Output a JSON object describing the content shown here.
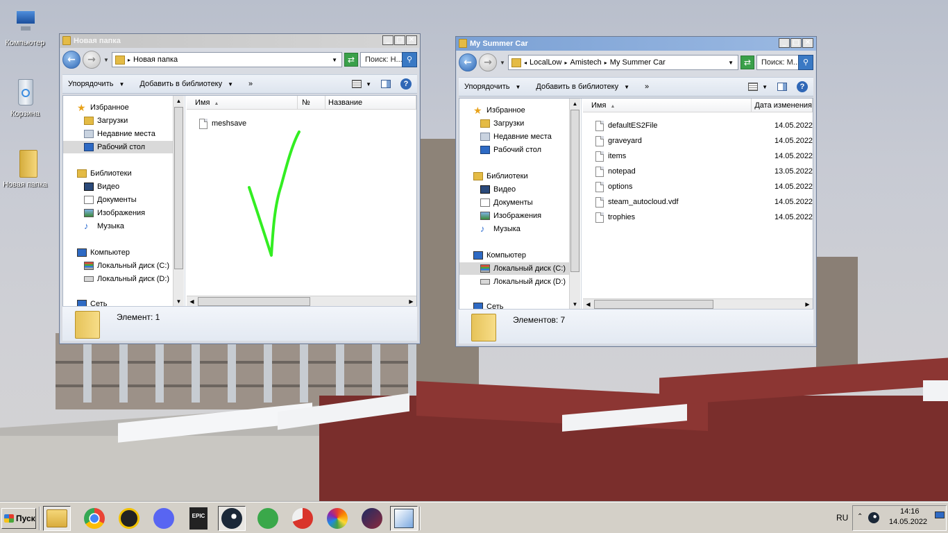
{
  "desktop": {
    "icons": [
      {
        "label": "Компьютер",
        "icon": "computer-icon"
      },
      {
        "label": "Корзина",
        "icon": "recycle-bin-icon"
      },
      {
        "label": "Новая папка",
        "icon": "folder-icon"
      }
    ]
  },
  "win1": {
    "title": "Новая папка",
    "path": [
      "Новая папка"
    ],
    "search_placeholder": "Поиск: Н...",
    "cmd": {
      "organize": "Упорядочить",
      "add_library": "Добавить в библиотеку",
      "more": "»"
    },
    "nav": {
      "favorites": "Избранное",
      "downloads": "Загрузки",
      "recent": "Недавние места",
      "desktop": "Рабочий стол",
      "libraries": "Библиотеки",
      "video": "Видео",
      "documents": "Документы",
      "pictures": "Изображения",
      "music": "Музыка",
      "computer": "Компьютер",
      "disk_c": "Локальный диск (C:)",
      "disk_d": "Локальный диск (D:)",
      "network": "Сеть"
    },
    "columns": [
      "Имя",
      "№",
      "Название"
    ],
    "files": [
      {
        "name": "meshsave"
      }
    ],
    "status": "Элемент: 1"
  },
  "win2": {
    "title": "My Summer Car",
    "path": [
      "LocalLow",
      "Amistech",
      "My Summer Car"
    ],
    "search_placeholder": "Поиск: M...",
    "cmd": {
      "organize": "Упорядочить",
      "add_library": "Добавить в библиотеку",
      "more": "»"
    },
    "nav": {
      "favorites": "Избранное",
      "downloads": "Загрузки",
      "recent": "Недавние места",
      "desktop": "Рабочий стол",
      "libraries": "Библиотеки",
      "video": "Видео",
      "documents": "Документы",
      "pictures": "Изображения",
      "music": "Музыка",
      "computer": "Компьютер",
      "disk_c": "Локальный диск (C:)",
      "disk_d": "Локальный диск (D:)",
      "network": "Сеть"
    },
    "columns": [
      "Имя",
      "Дата изменения"
    ],
    "files": [
      {
        "name": "defaultES2File",
        "date": "14.05.2022"
      },
      {
        "name": "graveyard",
        "date": "14.05.2022"
      },
      {
        "name": "items",
        "date": "14.05.2022"
      },
      {
        "name": "notepad",
        "date": "13.05.2022"
      },
      {
        "name": "options",
        "date": "14.05.2022"
      },
      {
        "name": "steam_autocloud.vdf",
        "date": "14.05.2022"
      },
      {
        "name": "trophies",
        "date": "14.05.2022"
      }
    ],
    "status": "Элементов: 7"
  },
  "taskbar": {
    "start_label": "Пуск",
    "apps": [
      "explorer-icon",
      "chrome-icon",
      "arc-icon",
      "discord-icon",
      "epic-games-icon",
      "steam-icon",
      "vpn-icon",
      "ccleaner-icon",
      "picasa-icon",
      "affinity-icon",
      "paint-icon"
    ],
    "lang": "RU",
    "time": "14:16",
    "date": "14.05.2022"
  },
  "colors": {
    "checkmark": "#33ee22",
    "titlebar_active": "#0a246a",
    "titlebar_inactive": "#7a96c2"
  }
}
